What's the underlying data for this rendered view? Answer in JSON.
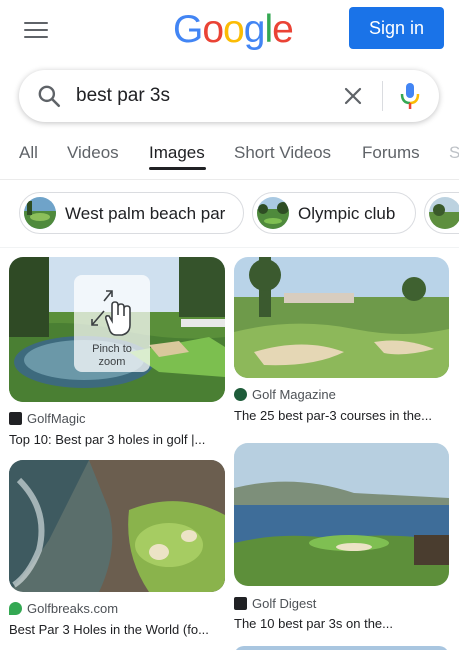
{
  "header": {
    "logo_letters": [
      {
        "ch": "G",
        "color": "#4285F4"
      },
      {
        "ch": "o",
        "color": "#EA4335"
      },
      {
        "ch": "o",
        "color": "#FBBC05"
      },
      {
        "ch": "g",
        "color": "#4285F4"
      },
      {
        "ch": "l",
        "color": "#34A853"
      },
      {
        "ch": "e",
        "color": "#EA4335"
      }
    ],
    "signin_label": "Sign in",
    "menu_icon": "hamburger-menu-icon"
  },
  "search": {
    "query": "best par 3s",
    "search_icon": "search-icon",
    "clear_icon": "close-icon",
    "mic_icon": "microphone-icon"
  },
  "tabs": {
    "items": [
      "All",
      "Videos",
      "Images",
      "Short Videos",
      "Forums",
      "S"
    ],
    "active": "Images"
  },
  "chips": [
    {
      "label": "West palm beach par"
    },
    {
      "label": "Olympic club"
    },
    {
      "label": ""
    }
  ],
  "results": [
    {
      "source": "GolfMagic",
      "title": "Top 10: Best par 3 holes in golf |...",
      "source_icon_color": "#202124"
    },
    {
      "source": "Golf Magazine",
      "title": "The 25 best par-3 courses in the...",
      "source_icon_color": "#1e5c3a"
    },
    {
      "source": "Golfbreaks.com",
      "title": "Best Par 3 Holes in the World (fo...",
      "source_icon_color": "#34A853"
    },
    {
      "source": "Golf Digest",
      "title": "The 10 best par 3s on the...",
      "source_icon_color": "#202124"
    }
  ],
  "overlay": {
    "pinch_label_1": "Pinch to",
    "pinch_label_2": "zoom",
    "icon": "pinch-gesture-icon"
  },
  "colors": {
    "accent": "#1a73e8",
    "text_primary": "#202124",
    "text_secondary": "#5f6368"
  }
}
